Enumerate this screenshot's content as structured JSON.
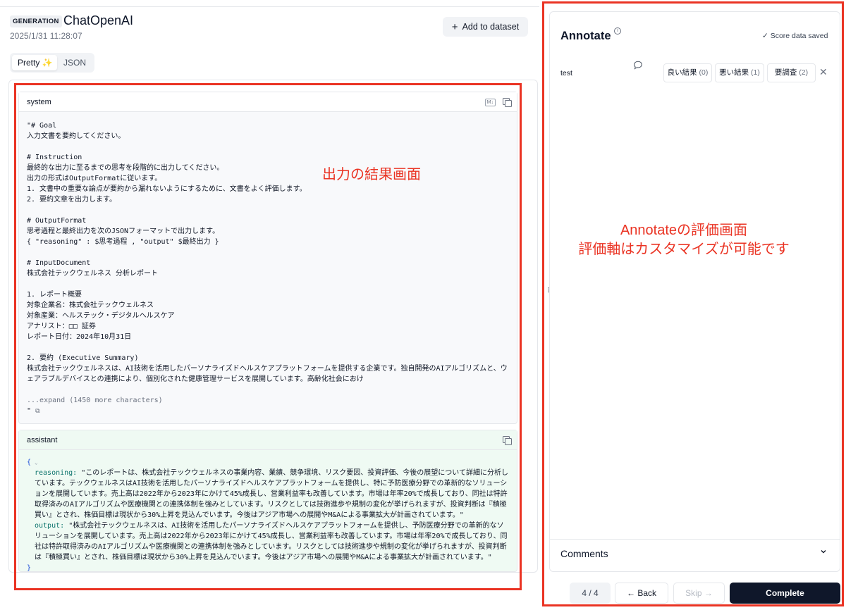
{
  "generation": {
    "badge": "GENERATION",
    "title": "ChatOpenAI",
    "timestamp": "2025/1/31 11:28:07",
    "add_to_dataset": "Add to dataset"
  },
  "view_toggle": {
    "pretty": "Pretty ✨",
    "json": "JSON"
  },
  "system_message": {
    "role": "system",
    "md_badge": "M↓",
    "content": "\"# Goal\n入力文書を要約してください。\n\n# Instruction\n最終的な出力に至るまでの思考を段階的に出力してください。\n出力の形式はOutputFormatに従います。\n1. 文書中の重要な論点が要約から漏れないようにするために、文書をよく評価します。\n2. 要約文章を出力します。\n\n# OutputFormat\n思考過程と最終出力を次のJSONフォーマットで出力します。\n{ \"reasoning\" : $思考過程 , \"output\" $最終出力 }\n\n# InputDocument\n株式会社テックウェルネス 分析レポート\n\n1. レポート概要\n対象企業名：株式会社テックウェルネス\n対象産業：ヘルステック・デジタルヘルスケア\nアナリスト：□□ 証券\nレポート日付：2024年10月31日\n\n2. 要約 (Executive Summary)\n株式会社テックウェルネスは、AI技術を活用したパーソナライズドヘルスケアプラットフォームを提供する企業です。独自開発のAIアルゴリズムと、ウ\nェアラブルデバイスとの連携により、個別化された健康管理サービスを展開しています。高齢化社会におけ",
    "expand": "...expand (1450 more characters)",
    "closing": "\""
  },
  "assistant_message": {
    "role": "assistant",
    "open_brace": "{",
    "close_brace": "}",
    "reasoning_key": "reasoning:",
    "reasoning_value": "\"このレポートは、株式会社テックウェルネスの事業内容、業績、競争環境、リスク要因、投資評価、今後の展望について詳細に分析しています。テックウェルネスはAI技術を活用したパーソナライズドヘルスケアプラットフォームを提供し、特に予防医療分野での革新的なソリューションを展開しています。売上高は2022年から2023年にかけて45%成長し、営業利益率も改善しています。市場は年率20%で成長しており、同社は特許取得済みのAIアルゴリズムや医療機関との連携体制を強みとしています。リスクとしては技術進歩や規制の変化が挙げられますが、投資判断は『積極買い』とされ、株価目標は現状から30%上昇を見込んでいます。今後はアジア市場への展開やM&Aによる事業拡大が計画されています。\"",
    "output_key": "output:",
    "output_value": "\"株式会社テックウェルネスは、AI技術を活用したパーソナライズドヘルスケアプラットフォームを提供し、予防医療分野での革新的なソリューションを展開しています。売上高は2022年から2023年にかけて45%成長し、営業利益率も改善しています。市場は年率20%で成長しており、同社は特許取得済みのAIアルゴリズムや医療機関との連携体制を強みとしています。リスクとしては技術進歩や規制の変化が挙げられますが、投資判断は『積極買い』とされ、株価目標は現状から30%上昇を見込んでいます。今後はアジア市場への展開やM&Aによる事業拡大が計画されています。\""
  },
  "annotations": {
    "left": "出力の結果画面",
    "right_line1": "Annotateの評価画面",
    "right_line2": "評価軸はカスタマイズが可能です"
  },
  "annotate_panel": {
    "title": "Annotate",
    "info_icon": "i",
    "saved_status": "✓ Score data saved",
    "score_name": "test",
    "options": [
      {
        "label": "良い結果",
        "count": "(0)"
      },
      {
        "label": "悪い結果",
        "count": "(1)"
      },
      {
        "label": "要調査",
        "count": "(2)"
      }
    ],
    "close": "✕",
    "comments": "Comments"
  },
  "footer": {
    "pager": "4 / 4",
    "back": "← Back",
    "skip": "Skip →",
    "complete": "Complete"
  },
  "drag_handle": "⠿"
}
